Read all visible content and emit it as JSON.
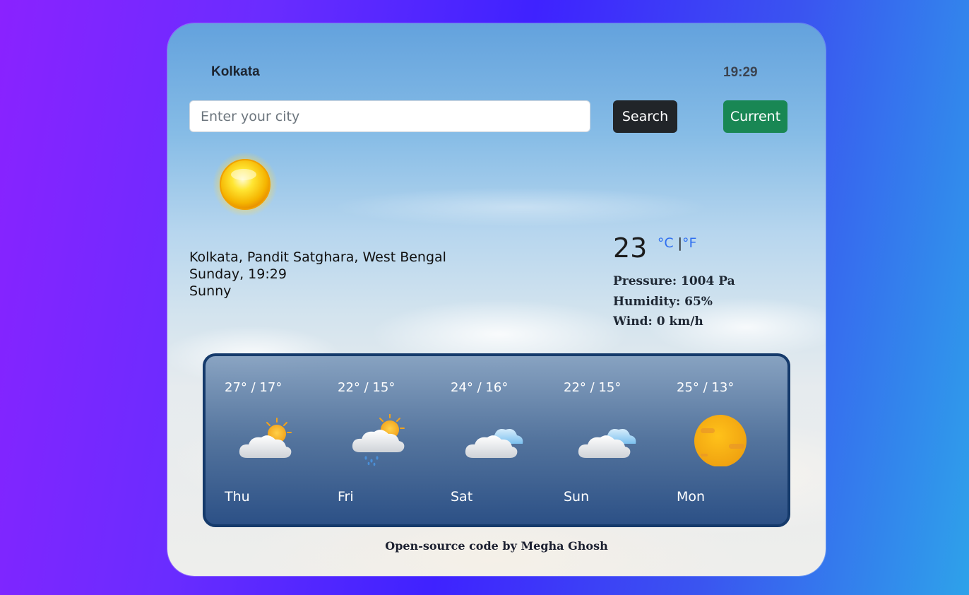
{
  "header": {
    "city": "Kolkata",
    "time": "19:29"
  },
  "search": {
    "placeholder": "Enter your city",
    "value": "",
    "search_label": "Search",
    "current_label": "Current"
  },
  "current": {
    "icon": "sun-icon",
    "location": "Kolkata, Pandit Satghara, West Bengal",
    "datetime": "Sunday, 19:29",
    "condition": "Sunny",
    "temperature": "23",
    "unit_c": "°C",
    "unit_sep": "|",
    "unit_f": "°F",
    "pressure": "Pressure: 1004 Pa",
    "humidity": "Humidity: 65%",
    "wind": "Wind: 0 km/h"
  },
  "forecast": [
    {
      "temp": "27° / 17°",
      "day": "Thu",
      "icon": "partly-cloudy-icon"
    },
    {
      "temp": "22° / 15°",
      "day": "Fri",
      "icon": "rain-sun-cloud-icon"
    },
    {
      "temp": "24° / 16°",
      "day": "Sat",
      "icon": "cloudy-icon"
    },
    {
      "temp": "22° / 15°",
      "day": "Sun",
      "icon": "cloudy-icon"
    },
    {
      "temp": "25° / 13°",
      "day": "Mon",
      "icon": "hazy-sun-icon"
    }
  ],
  "footer": "Open-source code by Megha Ghosh",
  "colors": {
    "search_button": "#212529",
    "current_button": "#198754",
    "unit_link": "#2f6ff0",
    "forecast_border": "#153a6b"
  }
}
